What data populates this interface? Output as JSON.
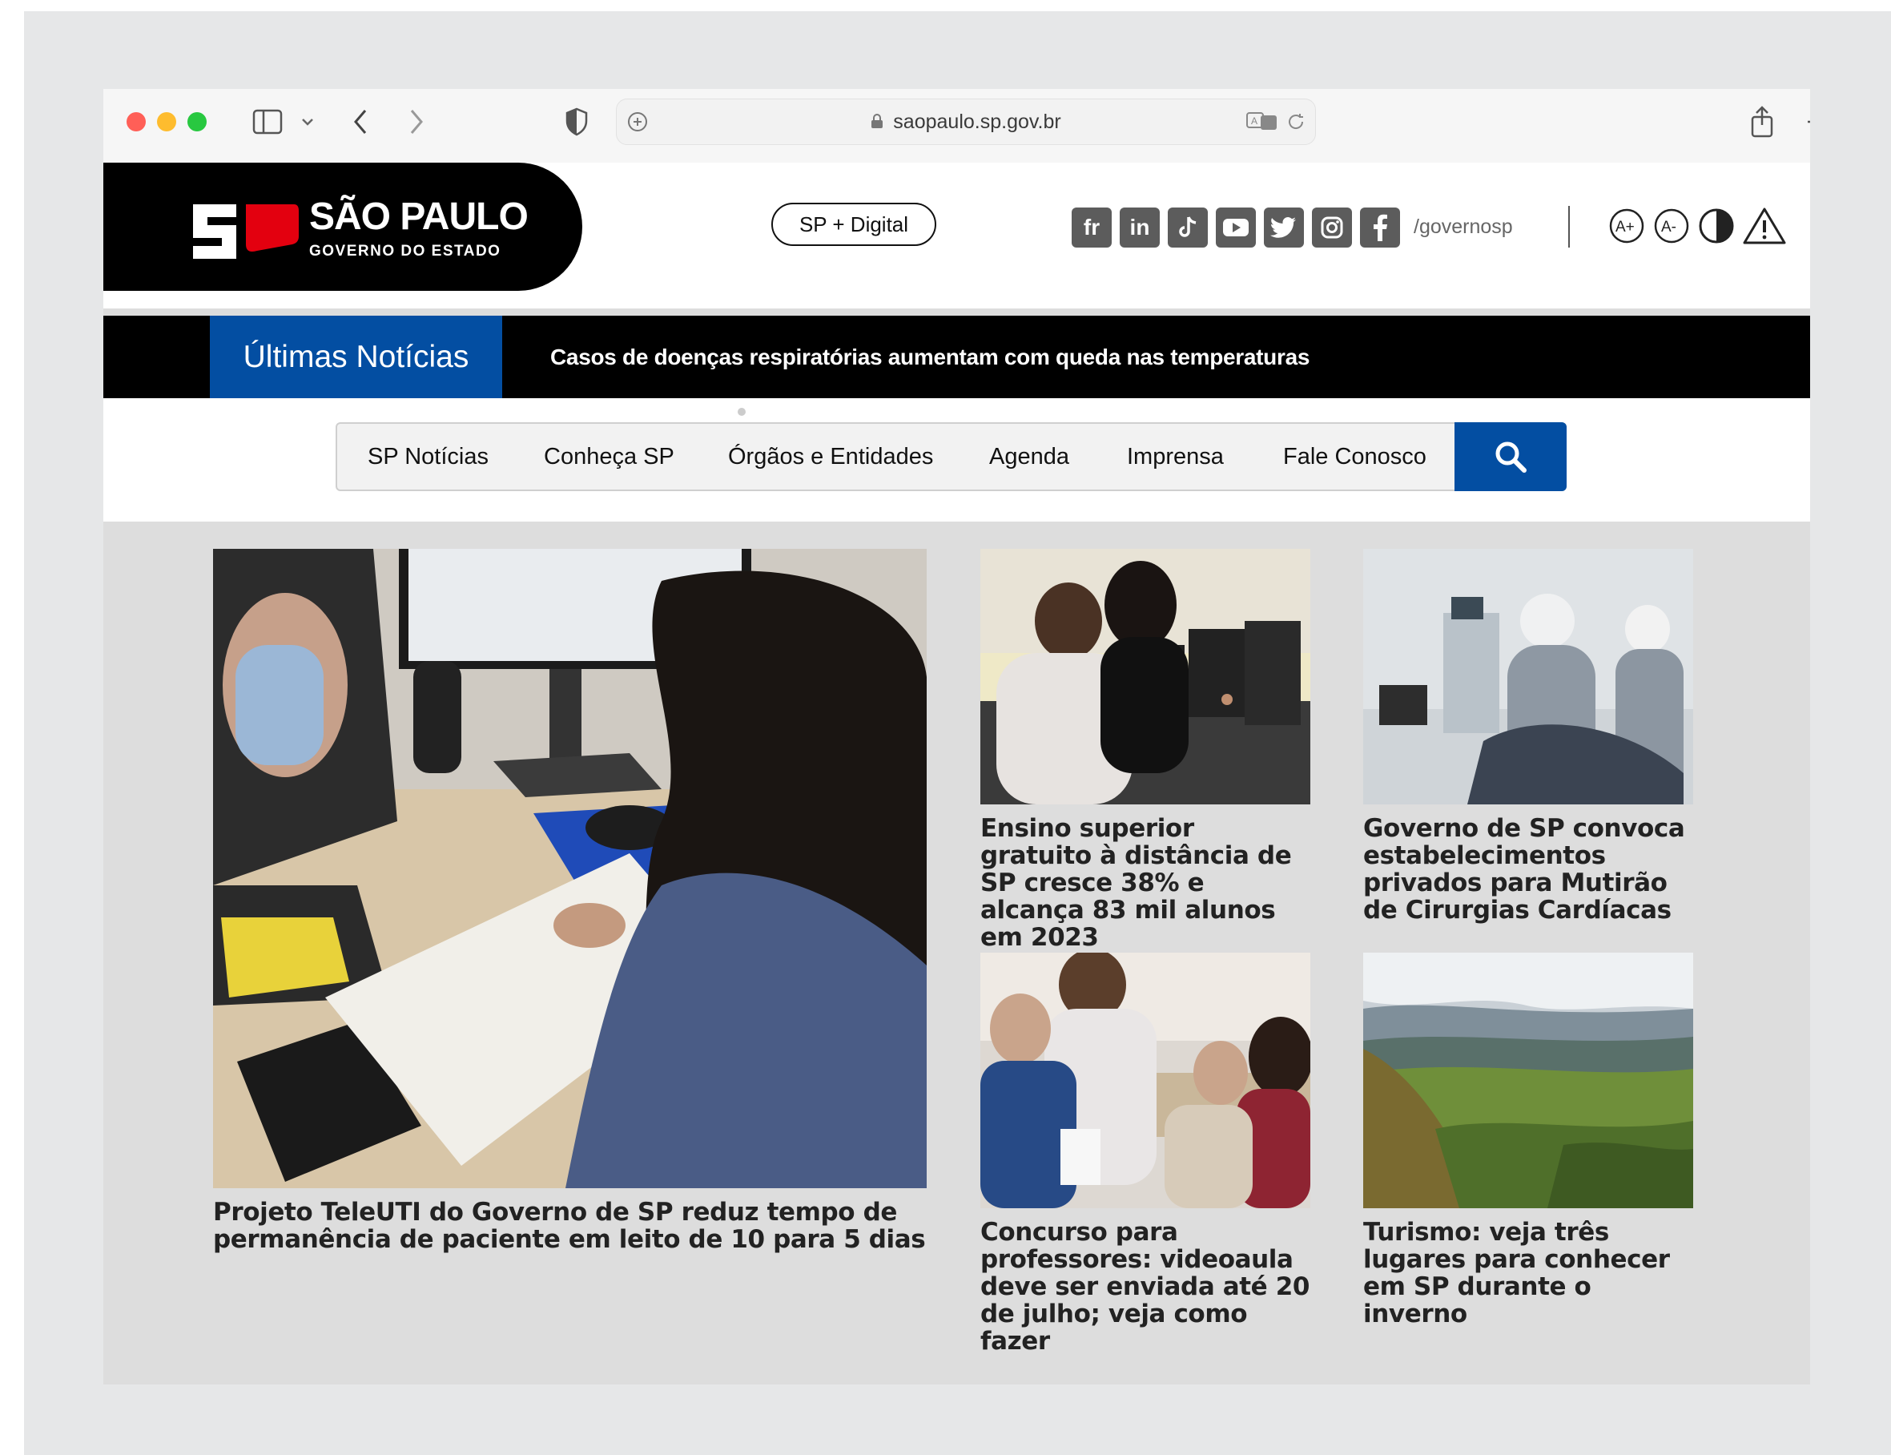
{
  "browser": {
    "url": "saopaulo.sp.gov.br"
  },
  "header": {
    "logo_title": "SÃO PAULO",
    "logo_subtitle": "GOVERNO DO ESTADO",
    "digital_button": "SP + Digital",
    "social_icons": [
      "flickr-icon",
      "linkedin-icon",
      "tiktok-icon",
      "youtube-icon",
      "twitter-icon",
      "instagram-icon",
      "facebook-icon"
    ],
    "social_handle": "/governosp",
    "accessibility": [
      "font-increase-icon",
      "font-decrease-icon",
      "contrast-icon",
      "alert-icon"
    ]
  },
  "ticker": {
    "label": "Últimas Notícias",
    "headline": "Casos de doenças respiratórias aumentam com queda nas temperaturas"
  },
  "nav": {
    "items": [
      "SP Notícias",
      "Conheça SP",
      "Órgãos e Entidades",
      "Agenda",
      "Imprensa",
      "Fale Conosco"
    ]
  },
  "news": {
    "main": "Projeto TeleUTI do Governo de SP reduz tempo de permanência de paciente em leito de 10 para 5 dias",
    "items": [
      "Ensino superior gratuito à distância de SP cresce 38% e alcança 83 mil alunos em 2023",
      "Governo de SP convoca estabelecimentos privados para Mutirão de Cirurgias Cardíacas",
      "Concurso para professores: videoaula deve ser enviada até 20 de julho; veja como fazer",
      "Turismo: veja três lugares para conhecer em SP durante o inverno"
    ]
  },
  "colors": {
    "brand_blue": "#034ea2",
    "brand_red": "#e3000f",
    "black": "#000000"
  }
}
